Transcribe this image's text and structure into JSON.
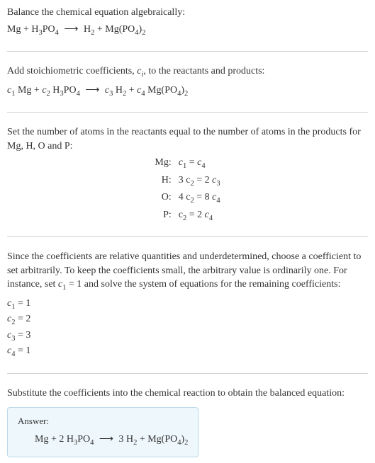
{
  "section1": {
    "intro": "Balance the chemical equation algebraically:",
    "eq_lhs1": "Mg",
    "eq_plus1": " + ",
    "eq_lhs2a": "H",
    "eq_lhs2b": "3",
    "eq_lhs2c": "PO",
    "eq_lhs2d": "4",
    "arrow": "⟶",
    "eq_rhs1a": "H",
    "eq_rhs1b": "2",
    "eq_plus2": " + ",
    "eq_rhs2a": "Mg(PO",
    "eq_rhs2b": "4",
    "eq_rhs2c": ")",
    "eq_rhs2d": "2"
  },
  "section2": {
    "intro_a": "Add stoichiometric coefficients, ",
    "intro_ci": "c",
    "intro_i": "i",
    "intro_b": ", to the reactants and products:",
    "c1": "c",
    "c1s": "1",
    "sp1": " Mg + ",
    "c2": "c",
    "c2s": "2",
    "sp2": " H",
    "sp2a": "3",
    "sp2b": "PO",
    "sp2c": "4",
    "arrow": "⟶",
    "c3": "c",
    "c3s": "3",
    "sp3": " H",
    "sp3a": "2",
    "plus": " + ",
    "c4": "c",
    "c4s": "4",
    "sp4": " Mg(PO",
    "sp4a": "4",
    "sp4b": ")",
    "sp4c": "2"
  },
  "section3": {
    "intro": "Set the number of atoms in the reactants equal to the number of atoms in the products for Mg, H, O and P:",
    "rows": {
      "mg_label": "Mg:",
      "mg_eq_a": "c",
      "mg_eq_as": "1",
      "mg_eq_mid": " = ",
      "mg_eq_b": "c",
      "mg_eq_bs": "4",
      "h_label": "H:",
      "h_eq_a": "3 c",
      "h_eq_as": "2",
      "h_eq_mid": " = 2 ",
      "h_eq_b": "c",
      "h_eq_bs": "3",
      "o_label": "O:",
      "o_eq_a": "4 c",
      "o_eq_as": "2",
      "o_eq_mid": " = 8 ",
      "o_eq_b": "c",
      "o_eq_bs": "4",
      "p_label": "P:",
      "p_eq_a": "c",
      "p_eq_as": "2",
      "p_eq_mid": " = 2 ",
      "p_eq_b": "c",
      "p_eq_bs": "4"
    }
  },
  "section4": {
    "intro_a": "Since the coefficients are relative quantities and underdetermined, choose a coefficient to set arbitrarily. To keep the coefficients small, the arbitrary value is ordinarily one. For instance, set ",
    "intro_c": "c",
    "intro_cs": "1",
    "intro_b": " = 1 and solve the system of equations for the remaining coefficients:",
    "rows": {
      "c1a": "c",
      "c1s": "1",
      "c1v": " = 1",
      "c2a": "c",
      "c2s": "2",
      "c2v": " = 2",
      "c3a": "c",
      "c3s": "3",
      "c3v": " = 3",
      "c4a": "c",
      "c4s": "4",
      "c4v": " = 1"
    }
  },
  "section5": {
    "intro": "Substitute the coefficients into the chemical reaction to obtain the balanced equation:",
    "answer_label": "Answer:",
    "eq_a": "Mg + 2 H",
    "eq_b": "3",
    "eq_c": "PO",
    "eq_d": "4",
    "arrow": "⟶",
    "eq_e": "3 H",
    "eq_f": "2",
    "eq_g": " + Mg(PO",
    "eq_h": "4",
    "eq_i": ")",
    "eq_j": "2"
  }
}
